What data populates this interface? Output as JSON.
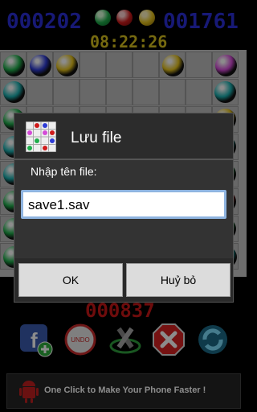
{
  "header": {
    "score_left": "000202",
    "score_right": "001761",
    "clock": "08:22:26",
    "next_balls": [
      "#1fae4b",
      "#d01b1b",
      "#e5c21c"
    ]
  },
  "board": {
    "rows": [
      [
        "#1fae4b",
        "#2e3cd6",
        "#e5c21c",
        null,
        null,
        null,
        "#e5c21c",
        null,
        "#d44ad7"
      ],
      [
        null,
        null,
        null,
        null,
        null,
        null,
        null,
        null,
        null
      ],
      [
        null,
        null,
        null,
        null,
        null,
        null,
        null,
        null,
        null
      ],
      [
        null,
        null,
        null,
        null,
        null,
        null,
        null,
        null,
        null
      ],
      [
        null,
        null,
        null,
        null,
        null,
        null,
        null,
        null,
        null
      ],
      [
        null,
        null,
        null,
        null,
        null,
        null,
        null,
        null,
        null
      ],
      [
        null,
        null,
        null,
        null,
        null,
        null,
        null,
        null,
        null
      ],
      [
        "#1fae4b",
        null,
        null,
        null,
        null,
        null,
        null,
        null,
        "#1ab0b0"
      ]
    ],
    "partial_left": [
      "#1ab0b0",
      "#1fae4b",
      "#1ab0b0",
      "#1ab0b0",
      "#1fae4b",
      "#1fae4b"
    ],
    "partial_right": [
      "#1ab0b0",
      "#e5c21c",
      "#1ab0b0",
      "#1fae4b",
      "#d01b1b",
      "#1fae4b"
    ]
  },
  "bonus_score": "000837",
  "toolbar": {
    "icons": [
      "facebook-add-icon",
      "undo-icon",
      "settings-tools-icon",
      "close-icon",
      "refresh-icon"
    ],
    "undo_label": "UNDO"
  },
  "ad": {
    "text": "One Click to Make Your Phone Faster !"
  },
  "dialog": {
    "title": "Lưu file",
    "prompt": "Nhập tên file:",
    "input_value": "save1.sav",
    "ok_label": "OK",
    "cancel_label": "Huỷ bỏ"
  },
  "colors": {
    "score_blue": "#2b2fd8",
    "clock_yellow": "#d8c21e",
    "bonus_red": "#c81616"
  }
}
